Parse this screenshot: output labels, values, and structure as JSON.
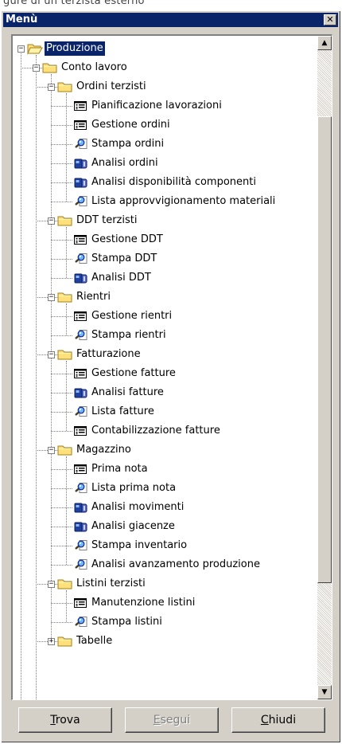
{
  "page_fragment": "gure di un terzista esterno",
  "window": {
    "title": "Menù",
    "close_label": "✕"
  },
  "tree": {
    "root": {
      "label": "Produzione",
      "icon": "open-folder-icon",
      "expanded": true,
      "selected": true
    },
    "items": [
      {
        "id": "conto-lavoro",
        "label": "Conto lavoro",
        "level": 1,
        "type": "folder",
        "expanded": true,
        "icon": "folder-icon"
      },
      {
        "id": "ordini-terzisti",
        "label": "Ordini terzisti",
        "level": 2,
        "type": "folder",
        "expanded": true,
        "icon": "folder-icon"
      },
      {
        "id": "pianificazione-lavorazioni",
        "label": "Pianificazione lavorazioni",
        "level": 3,
        "type": "form",
        "icon": "form-icon"
      },
      {
        "id": "gestione-ordini",
        "label": "Gestione ordini",
        "level": 3,
        "type": "form",
        "icon": "form-icon"
      },
      {
        "id": "stampa-ordini",
        "label": "Stampa ordini",
        "level": 3,
        "type": "report",
        "icon": "magnifier-icon"
      },
      {
        "id": "analisi-ordini",
        "label": "Analisi ordini",
        "level": 3,
        "type": "analysis",
        "icon": "analysis-icon"
      },
      {
        "id": "analisi-disponibilita-componenti",
        "label": "Analisi disponibilità componenti",
        "level": 3,
        "type": "analysis",
        "icon": "analysis-icon"
      },
      {
        "id": "lista-approvvigionamento-materiali",
        "label": "Lista approvvigionamento materiali",
        "level": 3,
        "type": "report",
        "icon": "magnifier-icon"
      },
      {
        "id": "ddt-terzisti",
        "label": "DDT terzisti",
        "level": 2,
        "type": "folder",
        "expanded": true,
        "icon": "folder-icon"
      },
      {
        "id": "gestione-ddt",
        "label": "Gestione DDT",
        "level": 3,
        "type": "form",
        "icon": "form-icon"
      },
      {
        "id": "stampa-ddt",
        "label": "Stampa DDT",
        "level": 3,
        "type": "report",
        "icon": "magnifier-icon"
      },
      {
        "id": "analisi-ddt",
        "label": "Analisi DDT",
        "level": 3,
        "type": "analysis",
        "icon": "analysis-icon"
      },
      {
        "id": "rientri",
        "label": "Rientri",
        "level": 2,
        "type": "folder",
        "expanded": true,
        "icon": "folder-icon"
      },
      {
        "id": "gestione-rientri",
        "label": "Gestione rientri",
        "level": 3,
        "type": "form",
        "icon": "form-icon"
      },
      {
        "id": "stampa-rientri",
        "label": "Stampa rientri",
        "level": 3,
        "type": "report",
        "icon": "magnifier-icon"
      },
      {
        "id": "fatturazione",
        "label": "Fatturazione",
        "level": 2,
        "type": "folder",
        "expanded": true,
        "icon": "folder-icon"
      },
      {
        "id": "gestione-fatture",
        "label": "Gestione fatture",
        "level": 3,
        "type": "form",
        "icon": "form-icon"
      },
      {
        "id": "analisi-fatture",
        "label": "Analisi fatture",
        "level": 3,
        "type": "analysis",
        "icon": "analysis-icon"
      },
      {
        "id": "lista-fatture",
        "label": "Lista fatture",
        "level": 3,
        "type": "report",
        "icon": "magnifier-icon"
      },
      {
        "id": "contabilizzazione-fatture",
        "label": "Contabilizzazione fatture",
        "level": 3,
        "type": "form",
        "icon": "form-icon"
      },
      {
        "id": "magazzino",
        "label": "Magazzino",
        "level": 2,
        "type": "folder",
        "expanded": true,
        "icon": "folder-icon"
      },
      {
        "id": "prima-nota",
        "label": "Prima nota",
        "level": 3,
        "type": "form",
        "icon": "form-icon"
      },
      {
        "id": "lista-prima-nota",
        "label": "Lista prima nota",
        "level": 3,
        "type": "report",
        "icon": "magnifier-icon"
      },
      {
        "id": "analisi-movimenti",
        "label": "Analisi movimenti",
        "level": 3,
        "type": "analysis",
        "icon": "analysis-icon"
      },
      {
        "id": "analisi-giacenze",
        "label": "Analisi giacenze",
        "level": 3,
        "type": "analysis",
        "icon": "analysis-icon"
      },
      {
        "id": "stampa-inventario",
        "label": "Stampa inventario",
        "level": 3,
        "type": "report",
        "icon": "magnifier-icon"
      },
      {
        "id": "analisi-avanzamento-produzione",
        "label": "Analisi avanzamento produzione",
        "level": 3,
        "type": "report",
        "icon": "magnifier-icon"
      },
      {
        "id": "listini-terzisti",
        "label": "Listini terzisti",
        "level": 2,
        "type": "folder",
        "expanded": true,
        "icon": "folder-icon"
      },
      {
        "id": "manutenzione-listini",
        "label": "Manutenzione listini",
        "level": 3,
        "type": "form",
        "icon": "form-icon"
      },
      {
        "id": "stampa-listini",
        "label": "Stampa listini",
        "level": 3,
        "type": "report",
        "icon": "magnifier-icon"
      },
      {
        "id": "tabelle",
        "label": "Tabelle",
        "level": 2,
        "type": "folder",
        "expanded": false,
        "icon": "folder-icon"
      }
    ]
  },
  "scrollbar": {
    "up_glyph": "▲",
    "down_glyph": "▼"
  },
  "buttons": {
    "trova": {
      "accel": "T",
      "rest": "rova",
      "enabled": true
    },
    "esegui": {
      "accel": "E",
      "rest": "segui",
      "enabled": false
    },
    "chiudi": {
      "accel": "C",
      "rest": "hiudi",
      "enabled": true
    }
  },
  "colors": {
    "selection": "#0a246a",
    "face": "#d4d0c8",
    "folder": "#ffe07a",
    "folder_edge": "#a08020",
    "form_border": "#000000"
  }
}
